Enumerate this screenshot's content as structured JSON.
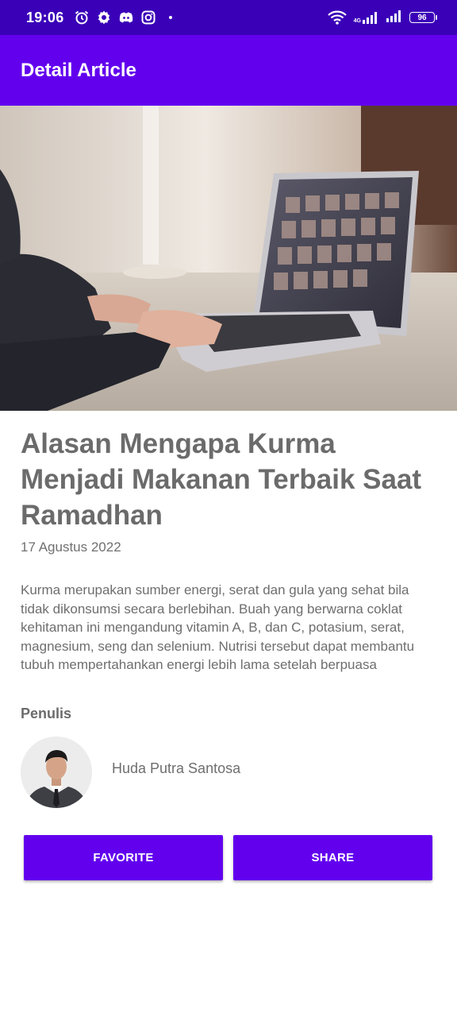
{
  "status_bar": {
    "time": "19:06",
    "icons_left": [
      "alarm-icon",
      "gear-icon",
      "discord-icon",
      "instagram-icon"
    ],
    "network_label": "4G",
    "battery": "96"
  },
  "app_bar": {
    "title": "Detail Article"
  },
  "article": {
    "image": "laptop-photo",
    "title": "Alasan Mengapa Kurma Menjadi Makanan Terbaik Saat Ramadhan",
    "date": "17 Agustus 2022",
    "body": "Kurma merupakan sumber energi, serat dan gula yang sehat bila tidak dikonsumsi secara berlebihan. Buah yang berwarna coklat kehitaman ini mengandung vitamin A, B, dan C, potasium, serat, magnesium, seng dan selenium. Nutrisi tersebut dapat membantu tubuh mempertahankan energi lebih lama setelah berpuasa"
  },
  "author": {
    "heading": "Penulis",
    "name": "Huda Putra Santosa"
  },
  "actions": {
    "favorite_label": "FAVORITE",
    "share_label": "SHARE"
  },
  "colors": {
    "status_bar": "#3a00b8",
    "primary": "#6200ee",
    "text_gray": "#6b6b6b"
  }
}
